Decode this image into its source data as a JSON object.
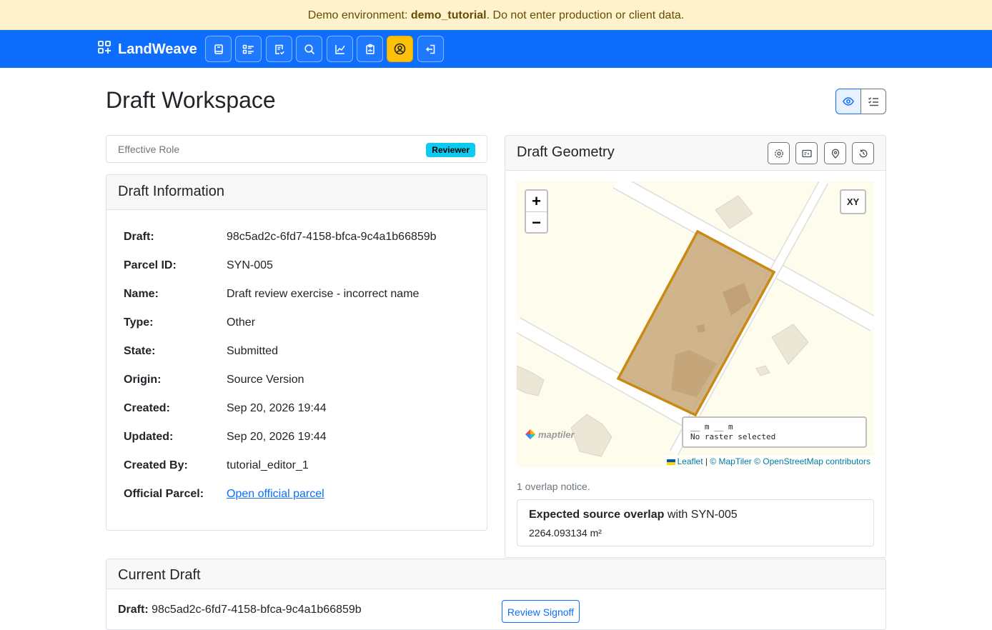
{
  "banner": {
    "prefix": "Demo environment: ",
    "env_name": "demo_tutorial",
    "suffix": ". Do not enter production or client data."
  },
  "navbar": {
    "brand": "LandWeave",
    "brand_icon": "grid-icon",
    "buttons": [
      {
        "icon": "book-icon"
      },
      {
        "icon": "list-details-icon"
      },
      {
        "icon": "checklist-icon"
      },
      {
        "icon": "search-icon"
      },
      {
        "icon": "chart-icon"
      },
      {
        "icon": "report-icon"
      },
      {
        "icon": "user-circle-icon",
        "active": true
      },
      {
        "icon": "logout-icon"
      }
    ]
  },
  "page": {
    "title": "Draft Workspace",
    "view_toggle": [
      {
        "icon": "eye-icon",
        "active": true
      },
      {
        "icon": "list-check-icon"
      }
    ]
  },
  "role": {
    "label": "Effective Role",
    "badge": "Reviewer"
  },
  "draft_info": {
    "title": "Draft Information",
    "rows": [
      {
        "label": "Draft:",
        "value": "98c5ad2c-6fd7-4158-bfca-9c4a1b66859b"
      },
      {
        "label": "Parcel ID:",
        "value": "SYN-005"
      },
      {
        "label": "Name:",
        "value": "Draft review exercise - incorrect name"
      },
      {
        "label": "Type:",
        "value": "Other"
      },
      {
        "label": "State:",
        "value": "Submitted"
      },
      {
        "label": "Origin:",
        "value": "Source Version"
      },
      {
        "label": "Created:",
        "value": "Sep 20, 2026 19:44"
      },
      {
        "label": "Updated:",
        "value": "Sep 20, 2026 19:44"
      },
      {
        "label": "Created By:",
        "value": "tutorial_editor_1"
      },
      {
        "label": "Official Parcel:",
        "value": "Open official parcel"
      }
    ]
  },
  "geometry": {
    "title": "Draft Geometry",
    "tools": [
      "settings-icon",
      "id-card-icon",
      "map-pin-icon",
      "history-icon"
    ],
    "map": {
      "zoom_in": "+",
      "zoom_out": "−",
      "xy_button": "XY",
      "coord_line1": "__ m __ m",
      "coord_line2": "No raster selected",
      "logo": "maptiler",
      "attribution": {
        "leaflet": "Leaflet",
        "separator": " | ",
        "maptiler": "© MapTiler",
        "osm": "© OpenStreetMap contributors"
      },
      "colors": {
        "parcel_fill": "#c8a77a",
        "parcel_stroke": "#c98a14",
        "land": "#fefcec"
      }
    },
    "notice_count": "1 overlap notice.",
    "overlap": {
      "title_bold": "Expected source overlap",
      "title_rest": " with SYN-005",
      "area": "2264.093134 m²"
    }
  },
  "current_draft": {
    "title": "Current Draft",
    "label": "Draft:",
    "value": "98c5ad2c-6fd7-4158-bfca-9c4a1b66859b",
    "review_button": "Review Signoff"
  }
}
